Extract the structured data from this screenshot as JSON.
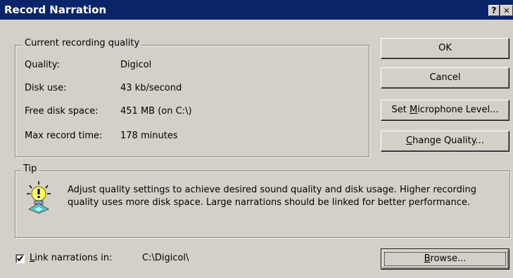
{
  "window": {
    "title": "Record Narration",
    "help_glyph": "?",
    "close_glyph": "✕"
  },
  "quality_group": {
    "legend": "Current recording quality",
    "rows": [
      {
        "label": "Quality:",
        "value": "Digicol"
      },
      {
        "label": "Disk use:",
        "value": "43 kb/second"
      },
      {
        "label": "Free disk space:",
        "value": "451 MB (on C:\\)"
      },
      {
        "label": "Max record time:",
        "value": "178 minutes"
      }
    ]
  },
  "buttons": {
    "ok": "OK",
    "cancel": "Cancel",
    "set_mic": {
      "mnemonic": "M",
      "rest_before": "Set ",
      "rest_after": "icrophone Level..."
    },
    "change_quality": {
      "mnemonic": "C",
      "rest_after": "hange Quality..."
    },
    "browse": {
      "mnemonic": "B",
      "rest_after": "rowse..."
    }
  },
  "tip_group": {
    "legend": "Tip",
    "icon": "lightbulb-icon",
    "text": "Adjust quality settings to achieve desired sound quality and disk usage. Higher recording quality uses more disk space. Large narrations should be linked for better performance."
  },
  "link": {
    "checked": true,
    "label_mnemonic": "L",
    "label_rest": "ink narrations in:",
    "path": "C:\\Digicol\\"
  },
  "colors": {
    "titlebar": "#0a246a",
    "face": "#d4d0c8"
  }
}
